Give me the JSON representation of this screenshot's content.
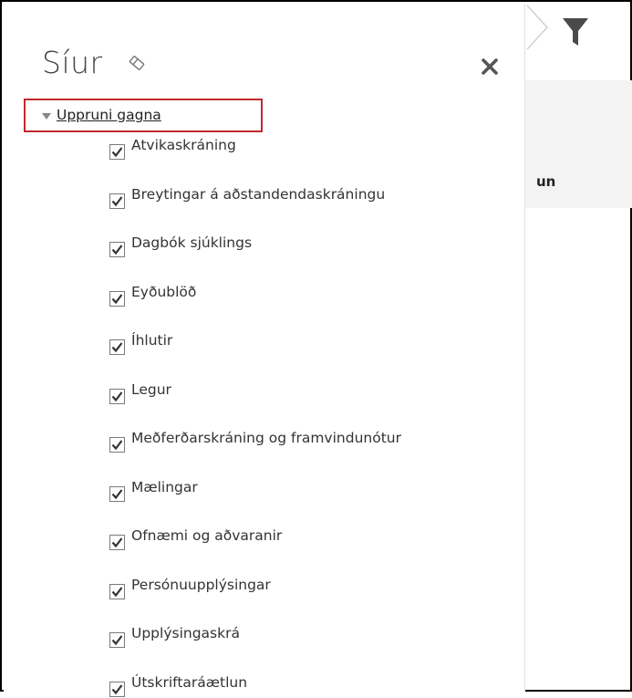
{
  "pane": {
    "title": "Síur",
    "group": {
      "label": "Uppruni gagna",
      "items": [
        {
          "label": "Atvikaskráning",
          "checked": true
        },
        {
          "label": "Breytingar á aðstandendaskráningu",
          "checked": true
        },
        {
          "label": "Dagbók sjúklings",
          "checked": true
        },
        {
          "label": "Eyðublöð",
          "checked": true
        },
        {
          "label": "Íhlutir",
          "checked": true
        },
        {
          "label": "Legur",
          "checked": true
        },
        {
          "label": "Meðferðarskráning og framvindunótur",
          "checked": true
        },
        {
          "label": "Mælingar",
          "checked": true
        },
        {
          "label": "Ofnæmi og aðvaranir",
          "checked": true
        },
        {
          "label": "Persónuupplýsingar",
          "checked": true
        },
        {
          "label": "Upplýsingaskrá",
          "checked": true
        },
        {
          "label": "Útskriftaráætlun",
          "checked": true
        }
      ]
    }
  },
  "background": {
    "partial_text": "un"
  },
  "colors": {
    "highlight_border": "#c0282d",
    "text": "#333333",
    "icon": "#555555"
  },
  "icons": {
    "eraser": "eraser-icon",
    "close": "close-icon",
    "caret": "caret-down-icon",
    "filter": "filter-icon",
    "check": "checkmark-icon"
  }
}
